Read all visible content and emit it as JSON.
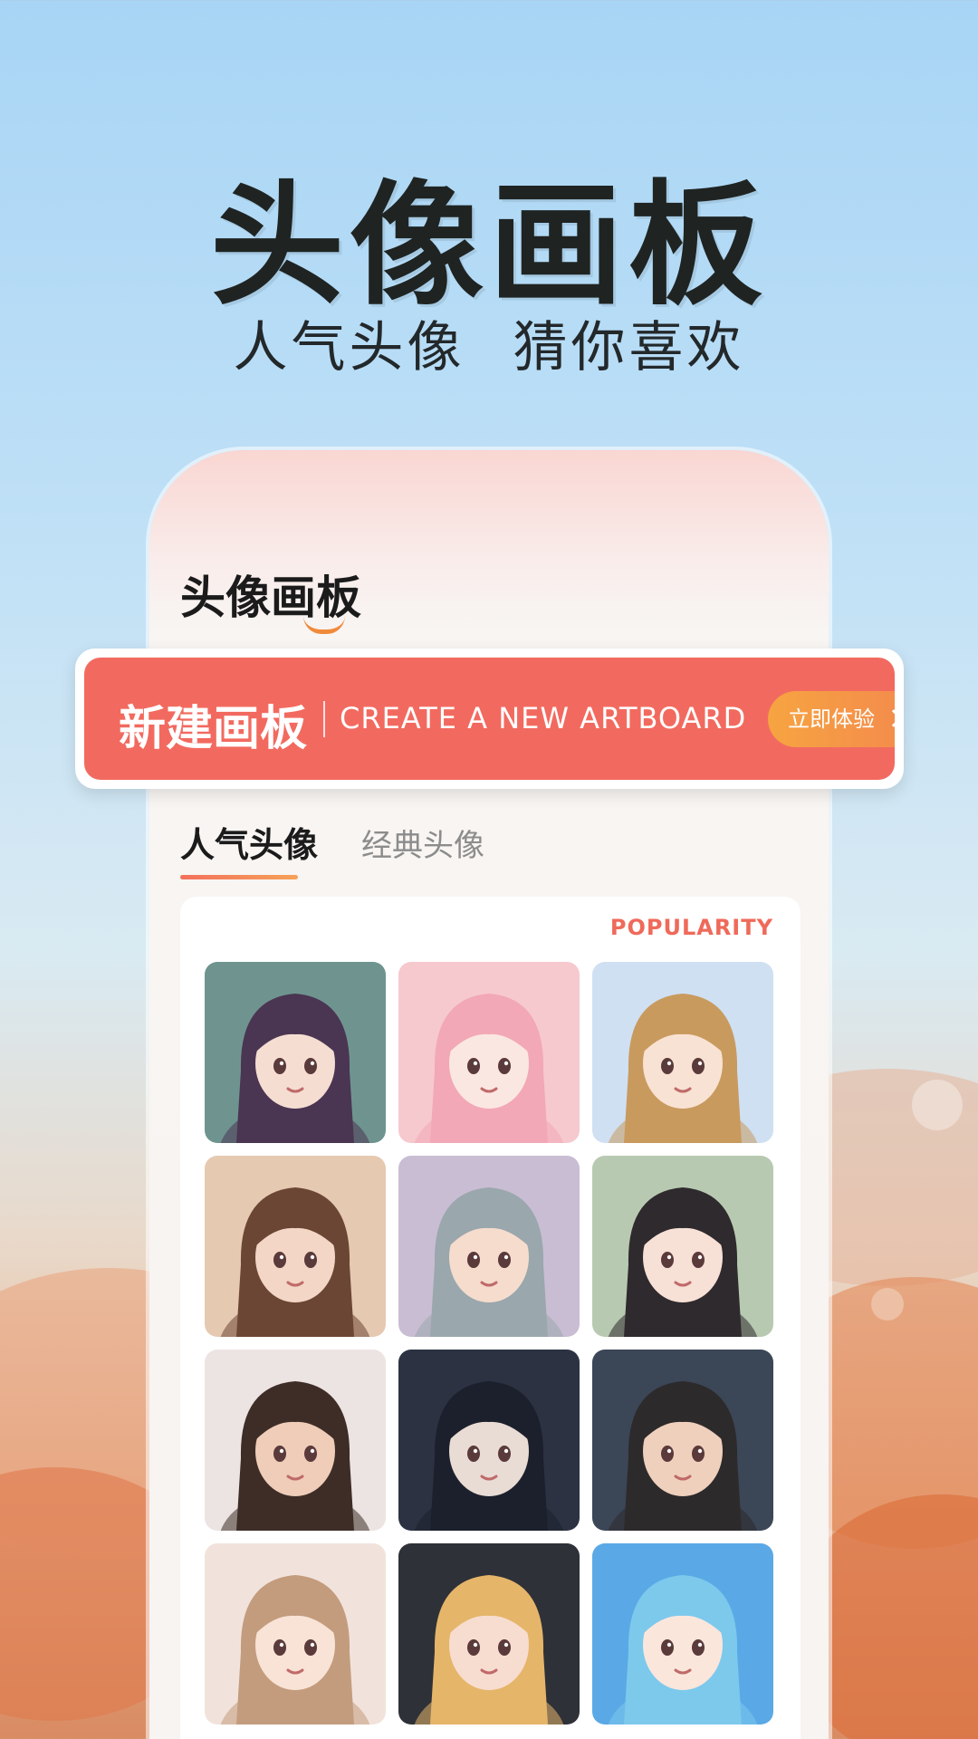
{
  "hero": {
    "title": "头像画板",
    "subtitle": "人气头像  猜你喜欢"
  },
  "app": {
    "title": "头像画板"
  },
  "banner": {
    "title": "新建画板",
    "subtitle_en": "CREATE A NEW ARTBOARD",
    "cta_label": "立即体验"
  },
  "tabs": [
    {
      "label": "人气头像",
      "active": true
    },
    {
      "label": "经典头像",
      "active": false
    }
  ],
  "section": {
    "badge": "POPULARITY"
  },
  "avatars": [
    {
      "name": "avatar-1",
      "bg": "#6f9490",
      "hair": "#4a3552",
      "skin": "#f5ddd2"
    },
    {
      "name": "avatar-2",
      "bg": "#f6c9cf",
      "hair": "#f2a8b6",
      "skin": "#fbe7e1"
    },
    {
      "name": "avatar-3",
      "bg": "#cfe0f3",
      "hair": "#c99a5e",
      "skin": "#f8e2d3"
    },
    {
      "name": "avatar-4",
      "bg": "#e6c9b1",
      "hair": "#6b4634",
      "skin": "#f3d6c5"
    },
    {
      "name": "avatar-5",
      "bg": "#c9bdd3",
      "hair": "#9aa7ad",
      "skin": "#f6dccd"
    },
    {
      "name": "avatar-6",
      "bg": "#b8c9b1",
      "hair": "#2f2a2e",
      "skin": "#f7e0d6"
    },
    {
      "name": "avatar-7",
      "bg": "#ece4e3",
      "hair": "#3e2d27",
      "skin": "#efcdb8"
    },
    {
      "name": "avatar-8",
      "bg": "#2c3242",
      "hair": "#1c202c",
      "skin": "#e9dcd4"
    },
    {
      "name": "avatar-9",
      "bg": "#3b4657",
      "hair": "#2d2a2b",
      "skin": "#efd0bd"
    },
    {
      "name": "avatar-10",
      "bg": "#f1e3dc",
      "hair": "#c39c7e",
      "skin": "#f8e3d6"
    },
    {
      "name": "avatar-11",
      "bg": "#2f3138",
      "hair": "#e5b56a",
      "skin": "#f7ddcf"
    },
    {
      "name": "avatar-12",
      "bg": "#5aa9e6",
      "hair": "#7cc9ec",
      "skin": "#fbe6dc"
    }
  ],
  "colors": {
    "accent": "#f26a5f",
    "cta": "#f6a441",
    "badge": "#ef6a5a"
  }
}
